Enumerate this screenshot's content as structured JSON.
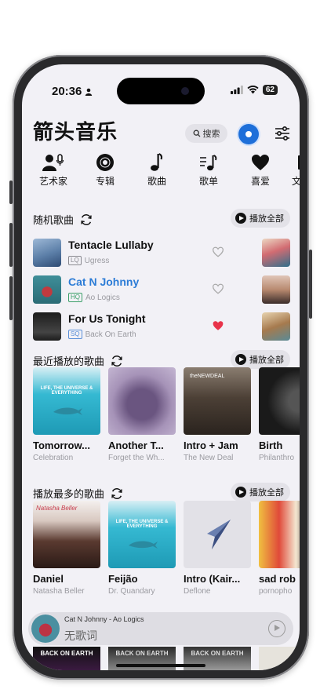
{
  "status_bar": {
    "time": "20:36",
    "battery": "62"
  },
  "header": {
    "logo": "箭头音乐",
    "search_label": "搜索"
  },
  "categories": [
    {
      "label": "艺术家",
      "icon": "artist-mic-icon"
    },
    {
      "label": "专辑",
      "icon": "album-disc-icon"
    },
    {
      "label": "歌曲",
      "icon": "music-note-icon"
    },
    {
      "label": "歌单",
      "icon": "playlist-icon"
    },
    {
      "label": "喜爱",
      "icon": "heart-icon"
    },
    {
      "label": "文",
      "icon": "folder-icon"
    }
  ],
  "random_section": {
    "title": "随机歌曲",
    "play_all": "播放全部"
  },
  "random_songs": [
    {
      "title": "Tentacle Lullaby",
      "quality": "LQ",
      "artist": "Ugress",
      "liked": false,
      "active": false
    },
    {
      "title": "Cat N Johnny",
      "quality": "HQ",
      "artist": "Ao Logics",
      "liked": false,
      "active": true
    },
    {
      "title": "For Us Tonight",
      "quality": "SQ",
      "artist": "Back On Earth",
      "liked": true,
      "active": false
    }
  ],
  "recent_section": {
    "title": "最近播放的歌曲",
    "play_all": "播放全部"
  },
  "recent_albums": [
    {
      "title": "Tomorrow...",
      "artist": "Celebration",
      "cover_text": "LIFE, THE UNIVERSE & EVERYTHING"
    },
    {
      "title": "Another T...",
      "artist": "Forget the Wh...",
      "cover_text": ""
    },
    {
      "title": "Intro + Jam",
      "artist": "The New Deal",
      "cover_text": "theNEWDEAL"
    },
    {
      "title": "Birth",
      "artist": "Philanthro",
      "cover_text": ""
    }
  ],
  "most_section": {
    "title": "播放最多的歌曲",
    "play_all": "播放全部"
  },
  "most_albums": [
    {
      "title": "Daniel",
      "artist": "Natasha Beller",
      "cover_text": "Natasha Beller"
    },
    {
      "title": "Feijão",
      "artist": "Dr. Quandary",
      "cover_text": "LIFE, THE UNIVERSE & EVERYTHING"
    },
    {
      "title": "Intro (Kair...",
      "artist": "Deflone",
      "cover_text": ""
    },
    {
      "title": "sad rob",
      "artist": "pornopho",
      "cover_text": ""
    }
  ],
  "mini_player": {
    "now_playing": "Cat N Johnny - Ao Logics",
    "lyric": "无歌词"
  },
  "bottom_peek": [
    "BACK ON EARTH",
    "BACK ON EARTH",
    "BACK ON EARTH"
  ],
  "colors": {
    "accent": "#2c7cd6",
    "liked": "#e8334a",
    "background": "#f2f1f6"
  }
}
